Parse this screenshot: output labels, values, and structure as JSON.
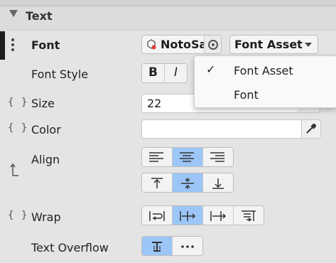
{
  "section": {
    "title": "Text"
  },
  "font_row": {
    "label": "Font",
    "value": "NotoSans",
    "asset_dropdown": "Font Asset"
  },
  "font_style": {
    "label": "Font Style",
    "bold": "B",
    "italic": "I"
  },
  "size": {
    "label": "Size",
    "value": "22"
  },
  "color": {
    "label": "Color"
  },
  "align": {
    "label": "Align"
  },
  "wrap": {
    "label": "Wrap"
  },
  "overflow": {
    "label": "Text Overflow"
  },
  "dropdown_menu": {
    "items": [
      {
        "label": "Font Asset",
        "checked": true,
        "check": "✓"
      },
      {
        "label": "Font",
        "checked": false,
        "check": ""
      }
    ]
  },
  "binding_marker": "{ }",
  "colors": {
    "selected": "#9cc6f7",
    "background": "#e4e4e4",
    "field": "#ffffff"
  }
}
